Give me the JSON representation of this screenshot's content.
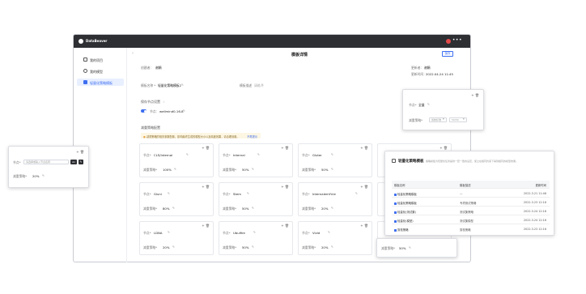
{
  "app": {
    "name": "DataBeaver"
  },
  "sidebar": {
    "items": [
      {
        "label": "我的项目"
      },
      {
        "label": "我的模型"
      },
      {
        "label": "轻量化策略模板"
      }
    ]
  },
  "header": {
    "title": "模板详情",
    "save_label": "保存"
  },
  "detail": {
    "creator_label": "创建者：",
    "creator_value": "谢娟",
    "updater_label": "更新者：",
    "updater_value": "谢娟",
    "updated_label": "更新时间：",
    "updated_value": "2022.04.24 11:45",
    "template_name_label": "模板名称 *",
    "template_name_value": "轻量化策略模板2",
    "template_desc_label": "模板描述",
    "template_desc_placeholder": "请输入"
  },
  "node_settings": {
    "title": "保存节点设置",
    "node_prefix": "节点：",
    "node_value": "wellmind0-16-8",
    "hint": "i"
  },
  "strategy": {
    "title": "减重策略配置",
    "notice": "减重策略的相关参数配置，影响最终生成的模型大小以及精度效果，请合理设置。",
    "notice_link": "不再提示"
  },
  "cards": [
    {
      "name_label": "节点*",
      "name": "CLS/Internal",
      "target_label": "减重策略*",
      "target": "100%"
    },
    {
      "name_label": "节点*",
      "name": "Internal",
      "target_label": "减重策略*",
      "target": "50%"
    },
    {
      "name_label": "节点*",
      "name": "Gluter",
      "target_label": "减重策略*",
      "target": "50%"
    },
    {
      "name_label": "节点*",
      "name": "Gluni",
      "target_label": "减重策略*",
      "target": "80%"
    },
    {
      "name_label": "节点*",
      "name": "Stem",
      "target_label": "减重策略*",
      "target": "50%"
    },
    {
      "name_label": "节点*",
      "name": "InternalemYnle",
      "target_label": "减重策略*",
      "target": "20%"
    },
    {
      "name_label": "节点*",
      "name": "LDNA",
      "target_label": "减重策略*",
      "target": "20%"
    },
    {
      "name_label": "节点*",
      "name": "Ubulfire",
      "target_label": "减重策略*",
      "target": "50%"
    },
    {
      "name_label": "节点*",
      "name": "Vivid",
      "target_label": "减重策略*",
      "target": "20%"
    }
  ],
  "popup_left": {
    "name_label": "节点*",
    "input_placeholder": "请选择或输入节点名称",
    "input_tag": "Ax",
    "target_label": "减重策略*",
    "target_value": "20%"
  },
  "popup_right_top": {
    "name_label": "节点*",
    "name_value": "全量",
    "target_label": "减重策略*",
    "select_1": "剪枝标准",
    "select_2": "50/50"
  },
  "popup_table": {
    "title": "轻量化策略模板",
    "subtitle": "策略模板为轻量化任务提供一套一致的设定，使之在相同约束下得到相同的模型效果。",
    "columns": [
      "模板名称",
      "模板描述",
      "更新时间"
    ],
    "rows": [
      {
        "name": "轻量化策略模板",
        "desc": "—",
        "time": "2022.3.21  11:46"
      },
      {
        "name": "轻量化策略模板",
        "desc": "专项测试策略",
        "time": "2022.3.23  12:16"
      },
      {
        "name": "轻量化(测试集)",
        "desc": "测试集策略",
        "time": "2022.3.24  12:16"
      },
      {
        "name": "轻量化(模型)",
        "desc": "测试集模型",
        "time": "2022.3.24  12:16"
      },
      {
        "name": "剪枝策略",
        "desc": "剪枝策略",
        "time": "2022.3.23  12:16"
      }
    ]
  },
  "popup_bottom": {
    "target_label": "减重策略*",
    "target_value": "50%"
  }
}
